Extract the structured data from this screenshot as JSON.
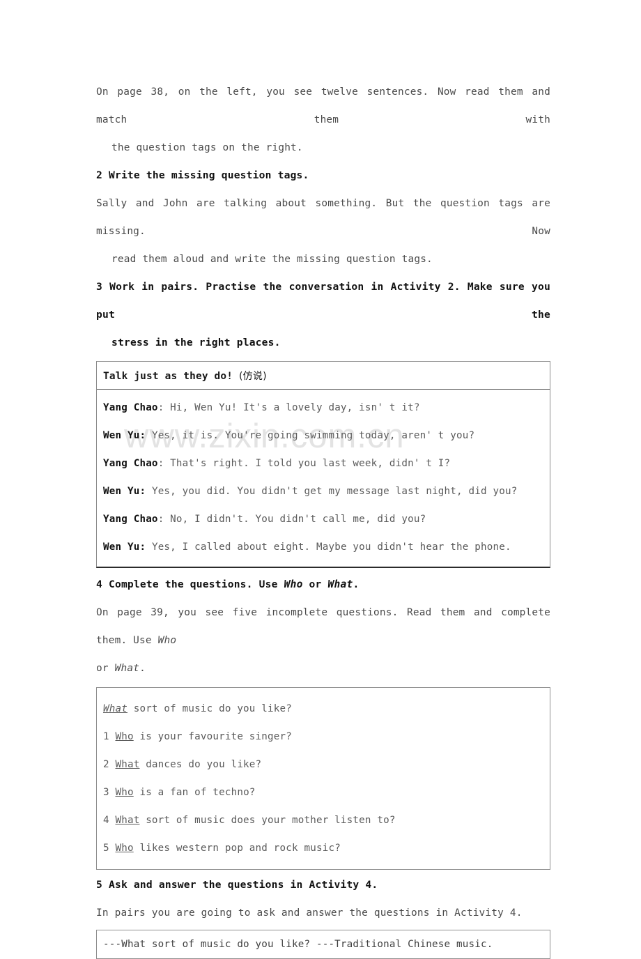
{
  "document": {
    "watermark": "www.zixin.com.cn",
    "intro": {
      "line1": "On page 38, on the left, you see twelve sentences. Now read them and match them with",
      "line2": "the question tags on the right."
    },
    "activity2": {
      "heading": "2 Write the missing question tags.",
      "body_line1": "Sally and John are talking about something. But the question tags are missing. Now",
      "body_line2": "read them aloud and write the missing question tags."
    },
    "activity3": {
      "heading_line1": "3 Work in pairs. Practise the conversation in Activity 2. Make sure you put the",
      "heading_line2": "stress in the right places.",
      "table_title_en": "Talk just as they do! ",
      "table_title_cn": "(仿说)",
      "dialogue": [
        {
          "speaker": "Yang Chao",
          "separator": ": ",
          "text": "Hi, Wen Yu! It's a lovely day, isn' t it?"
        },
        {
          "speaker": "Wen Yu:",
          "separator": " ",
          "text": "Yes, it is. You're going swimming today, aren' t you?"
        },
        {
          "speaker": "Yang Chao",
          "separator": ": ",
          "text": "That's right. I told you last week, didn' t I?"
        },
        {
          "speaker": "Wen Yu:",
          "separator": " ",
          "text": "Yes, you did. You didn't get my message last night, did you?"
        },
        {
          "speaker": "Yang Chao",
          "separator": ": ",
          "text": "No, I didn't. You didn't call me, did you?"
        },
        {
          "speaker": "Wen Yu:",
          "separator": " ",
          "text": "Yes, I called about eight. Maybe you didn't hear the phone."
        }
      ]
    },
    "activity4": {
      "heading_pre": "4 Complete the questions. Use ",
      "heading_em1": "Who",
      "heading_mid": " or ",
      "heading_em2": "What",
      "heading_post": ".",
      "body_line1_pre": "On page 39, you see five incomplete questions. Read them and complete them. Use ",
      "body_line1_em": "Who",
      "body_line2_pre": "or ",
      "body_line2_em": "What",
      "body_line2_post": ".",
      "questions": [
        {
          "number": "",
          "answer": "What",
          "answer_style": "italic-underline",
          "rest": " sort of music do you like?"
        },
        {
          "number": "1",
          "answer": "Who",
          "answer_style": "underline",
          "rest": " is your favourite singer?"
        },
        {
          "number": "2",
          "answer": "What",
          "answer_style": "underline",
          "rest": " dances do you like?"
        },
        {
          "number": "3",
          "answer": "Who",
          "answer_style": "underline",
          "rest": " is a fan of techno?"
        },
        {
          "number": "4",
          "answer": "What",
          "answer_style": "underline",
          "rest": " sort of music does your mother listen to?"
        },
        {
          "number": "5",
          "answer": "Who",
          "answer_style": "underline",
          "rest": " likes western pop and rock music?"
        }
      ]
    },
    "activity5": {
      "heading": "5 Ask and answer the questions in Activity 4.",
      "body": "In pairs you are going to ask and answer the questions in Activity 4.",
      "example": "---What sort of music do you like? ---Traditional Chinese music."
    }
  }
}
